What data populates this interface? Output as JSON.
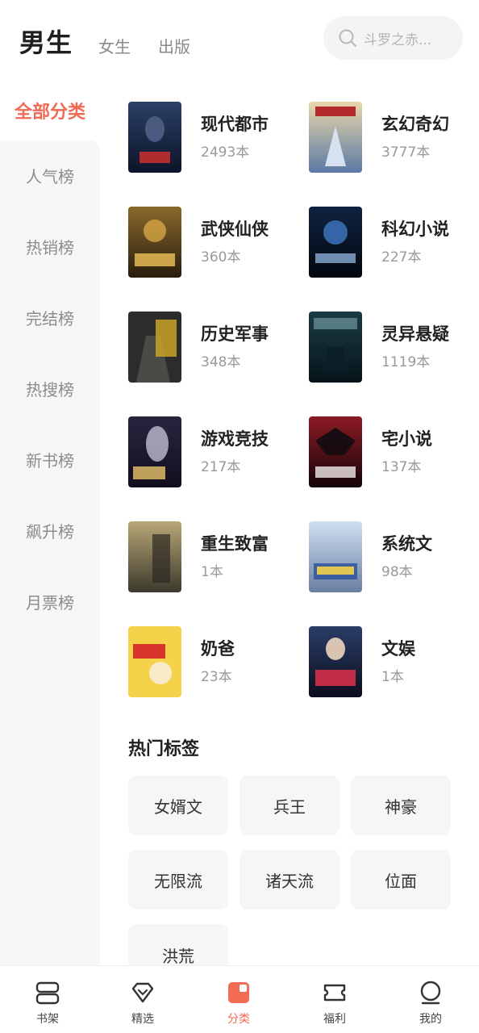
{
  "header": {
    "tabs": [
      "男生",
      "女生",
      "出版"
    ],
    "search_placeholder": "斗罗之赤..."
  },
  "sidebar": {
    "items": [
      "全部分类",
      "人气榜",
      "热销榜",
      "完结榜",
      "热搜榜",
      "新书榜",
      "飙升榜",
      "月票榜"
    ]
  },
  "categories": [
    {
      "name": "现代都市",
      "count": "2493本"
    },
    {
      "name": "玄幻奇幻",
      "count": "3777本"
    },
    {
      "name": "武侠仙侠",
      "count": "360本"
    },
    {
      "name": "科幻小说",
      "count": "227本"
    },
    {
      "name": "历史军事",
      "count": "348本"
    },
    {
      "name": "灵异悬疑",
      "count": "1119本"
    },
    {
      "name": "游戏竞技",
      "count": "217本"
    },
    {
      "name": "宅小说",
      "count": "137本"
    },
    {
      "name": "重生致富",
      "count": "1本"
    },
    {
      "name": "系统文",
      "count": "98本"
    },
    {
      "name": "奶爸",
      "count": "23本"
    },
    {
      "name": "文娱",
      "count": "1本"
    }
  ],
  "hot_tags": {
    "title": "热门标签",
    "items": [
      "女婿文",
      "兵王",
      "神豪",
      "无限流",
      "诸天流",
      "位面",
      "洪荒"
    ]
  },
  "bottom_nav": {
    "items": [
      "书架",
      "精选",
      "分类",
      "福利",
      "我的"
    ],
    "active": "分类"
  },
  "colors": {
    "accent": "#ef6a54",
    "sidebar_bg": "#f7f7f7",
    "tag_bg": "#f6f6f6"
  }
}
